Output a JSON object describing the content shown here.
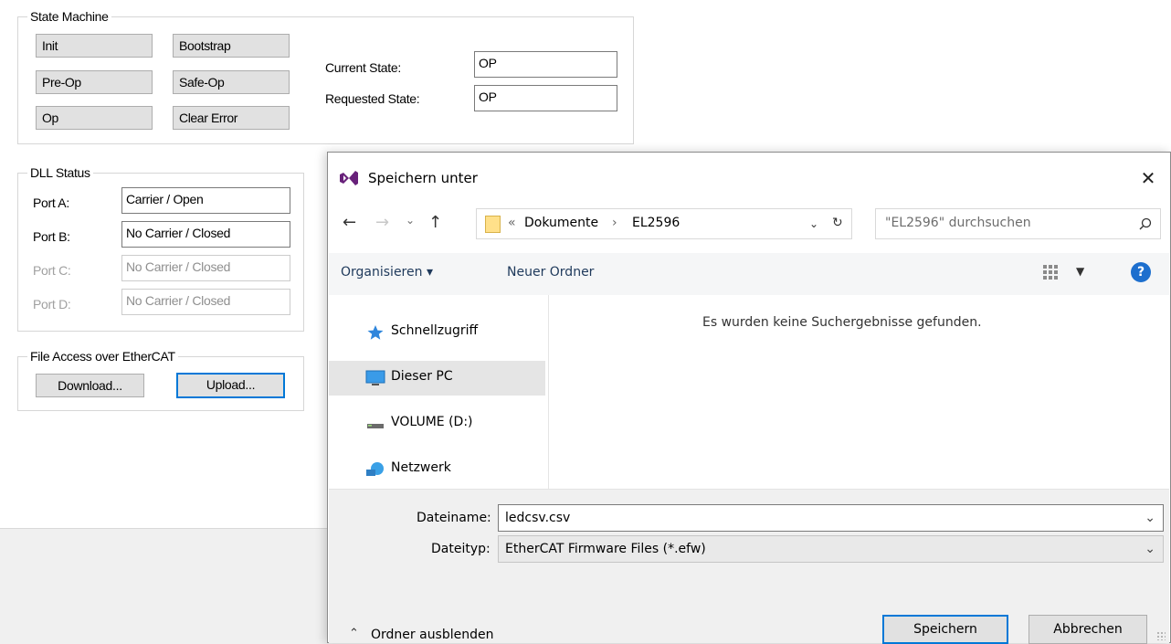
{
  "app": {
    "state_machine": {
      "legend": "State Machine",
      "buttons": [
        "Init",
        "Bootstrap",
        "Pre-Op",
        "Safe-Op",
        "Op",
        "Clear Error"
      ],
      "current_state_label": "Current State:",
      "current_state_value": "OP",
      "requested_state_label": "Requested State:",
      "requested_state_value": "OP"
    },
    "dll_status": {
      "legend": "DLL Status",
      "ports": [
        {
          "label": "Port A:",
          "value": "Carrier / Open",
          "enabled": true
        },
        {
          "label": "Port B:",
          "value": "No Carrier / Closed",
          "enabled": true
        },
        {
          "label": "Port C:",
          "value": "No Carrier / Closed",
          "enabled": false
        },
        {
          "label": "Port D:",
          "value": "No Carrier / Closed",
          "enabled": false
        }
      ]
    },
    "file_access": {
      "legend": "File Access over EtherCAT",
      "download_label": "Download...",
      "upload_label": "Upload..."
    }
  },
  "dialog": {
    "title": "Speichern unter",
    "close_icon": "close-icon",
    "address": {
      "prefix": "«",
      "crumbs": [
        "Dokumente",
        "EL2596"
      ],
      "separator": "›"
    },
    "search_placeholder": "\"EL2596\" durchsuchen",
    "toolbar": {
      "organize_label": "Organisieren ▾",
      "new_folder_label": "Neuer Ordner",
      "help_label": "?"
    },
    "nav_items": [
      {
        "label": "Schnellzugriff",
        "icon": "star-icon",
        "selected": false
      },
      {
        "label": "Dieser PC",
        "icon": "computer-icon",
        "selected": true
      },
      {
        "label": "VOLUME (D:)",
        "icon": "drive-icon",
        "selected": false
      },
      {
        "label": "Netzwerk",
        "icon": "network-icon",
        "selected": false
      }
    ],
    "empty_message": "Es wurden keine Suchergebnisse gefunden.",
    "filename_label": "Dateiname:",
    "filename_value": "ledcsv.csv",
    "filetype_label": "Dateityp:",
    "filetype_value": "EtherCAT Firmware Files (*.efw)",
    "hide_folders_label": "Ordner ausblenden",
    "save_label": "Speichern",
    "cancel_label": "Abbrechen"
  },
  "colors": {
    "accent": "#0078d7",
    "dialog_icon": "#68217a",
    "help": "#1d6fce"
  }
}
